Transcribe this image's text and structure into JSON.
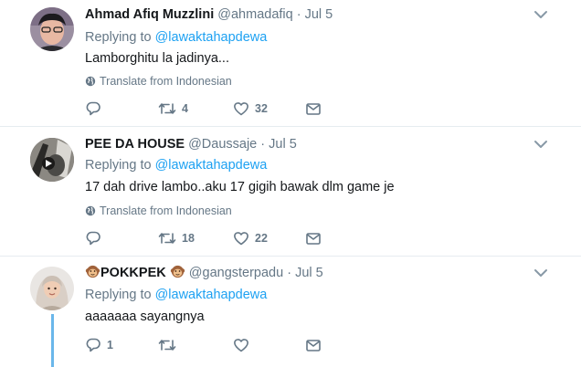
{
  "tweets": [
    {
      "name": "Ahmad Afiq Muzzlini",
      "handle": "@ahmadafiq",
      "dot": "·",
      "time": "Jul 5",
      "replying_prefix": "Replying to ",
      "replying_to": "@lawaktahapdewa",
      "text": "Lamborghitu la jadinya...",
      "translate": "Translate from Indonesian",
      "reply_count": "",
      "retweet_count": "4",
      "like_count": "32"
    },
    {
      "name": "PEE DA HOUSE",
      "handle": "@Daussaje",
      "dot": "·",
      "time": "Jul 5",
      "replying_prefix": "Replying to ",
      "replying_to": "@lawaktahapdewa",
      "text": "17 dah drive lambo..aku 17 gigih bawak dlm game je",
      "translate": "Translate from Indonesian",
      "reply_count": "",
      "retweet_count": "18",
      "like_count": "22"
    },
    {
      "name": "POKKPEK",
      "handle": "@gangsterpadu",
      "dot": "·",
      "time": "Jul 5",
      "replying_prefix": "Replying to ",
      "replying_to": "@lawaktahapdewa",
      "text": "aaaaaaa sayangnya",
      "reply_count": "1",
      "retweet_count": "",
      "like_count": ""
    }
  ],
  "icons": {
    "name_emoji": "monkey-emoji",
    "caret": "chevron-down-icon",
    "globe": "globe-icon",
    "reply": "reply-icon",
    "retweet": "retweet-icon",
    "like": "heart-icon",
    "dm": "envelope-icon"
  },
  "colors": {
    "link": "#1da1f2",
    "muted": "#657786",
    "thread_line": "#6ab7ea",
    "divider": "#e6ecf0"
  }
}
